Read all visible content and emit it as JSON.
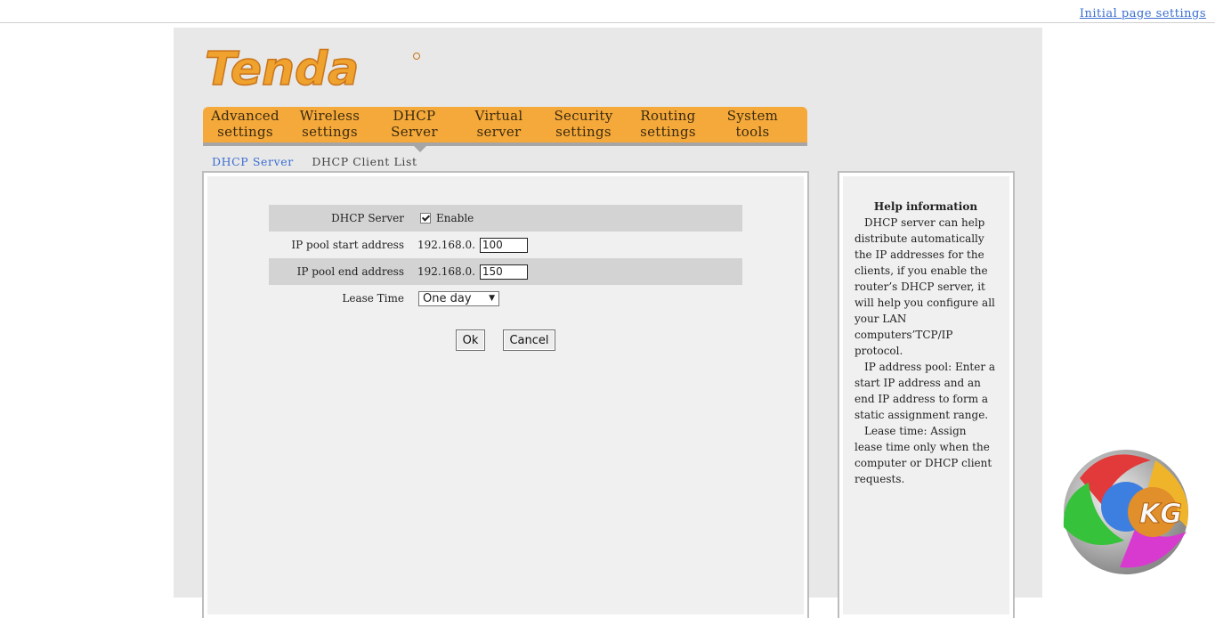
{
  "header": {
    "initial_link": "Initial page settings"
  },
  "logo": {
    "text": "Tenda",
    "color": "#f0a22e"
  },
  "nav": {
    "items": [
      {
        "line1": "Advanced",
        "line2": "settings"
      },
      {
        "line1": "Wireless",
        "line2": "settings"
      },
      {
        "line1": "DHCP",
        "line2": "Server"
      },
      {
        "line1": "Virtual",
        "line2": "server"
      },
      {
        "line1": "Security",
        "line2": "settings"
      },
      {
        "line1": "Routing",
        "line2": "settings"
      },
      {
        "line1": "System",
        "line2": "tools"
      }
    ],
    "active_index": 2,
    "accent": "#f5a93a"
  },
  "subnav": {
    "active": "DHCP Server",
    "inactive": "DHCP Client List"
  },
  "form": {
    "dhcp_server_label": "DHCP Server",
    "enable_label": "Enable",
    "enable_checked": true,
    "start_label": "IP pool start address",
    "start_prefix": "192.168.0.",
    "start_value": "100",
    "end_label": "IP pool end address",
    "end_prefix": "192.168.0.",
    "end_value": "150",
    "lease_label": "Lease Time",
    "lease_value": "One day",
    "ok_label": "Ok",
    "cancel_label": "Cancel"
  },
  "help": {
    "title": "Help information",
    "p1": "DHCP server can help distribute automatically the IP addresses for the clients, if you enable the router’s DHCP server, it will help you configure all your LAN computers’TCP/IP protocol.",
    "p2": "IP address pool: Enter a start IP address and an end IP address to form a static assignment range.",
    "p3": "Lease time: Assign lease time only when the computer or DHCP client requests."
  },
  "watermark": {
    "text": "KG"
  }
}
